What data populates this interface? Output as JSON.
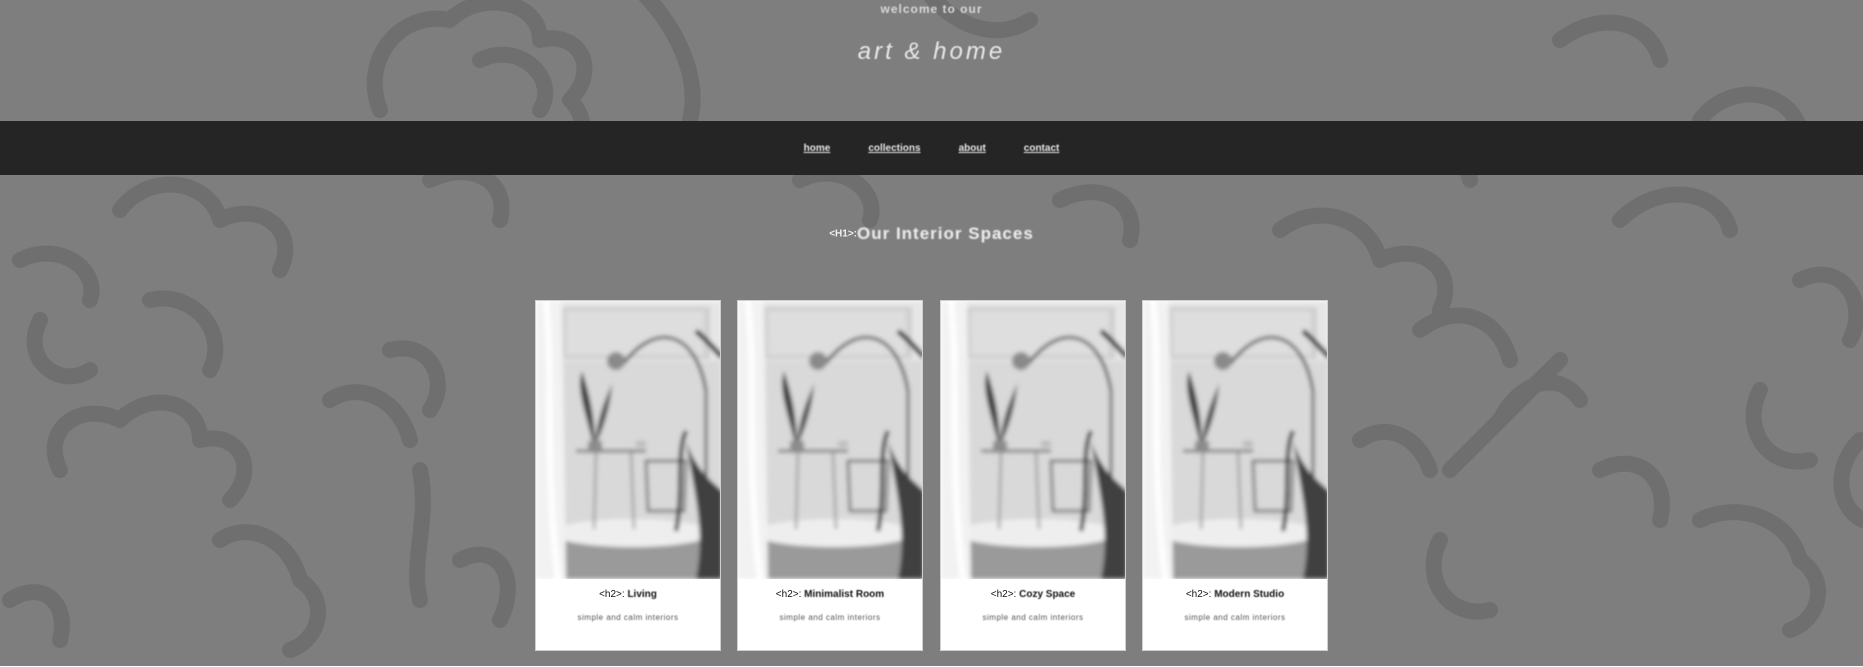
{
  "header": {
    "kicker": "welcome to our",
    "title": "art & home"
  },
  "nav": {
    "items": [
      {
        "label": "home"
      },
      {
        "label": "collections"
      },
      {
        "label": "about"
      },
      {
        "label": "contact"
      }
    ]
  },
  "hero": {
    "tag": "<H1>:",
    "title": "Our Interior Spaces"
  },
  "cards": [
    {
      "tag": "<h2>:",
      "name": "Living",
      "desc": "simple and calm interiors",
      "image": "living-room-photo"
    },
    {
      "tag": "<h2>:",
      "name": "Minimalist Room",
      "desc": "simple and calm interiors",
      "image": "living-room-photo"
    },
    {
      "tag": "<h2>:",
      "name": "Cozy Space",
      "desc": "simple and calm interiors",
      "image": "living-room-photo"
    },
    {
      "tag": "<h2>:",
      "name": "Modern Studio",
      "desc": "simple and calm interiors",
      "image": "living-room-photo"
    }
  ],
  "colors": {
    "background": "#7e7e7e",
    "pattern": "#6e6e6e",
    "navbar": "#252525",
    "card": "#ffffff"
  }
}
